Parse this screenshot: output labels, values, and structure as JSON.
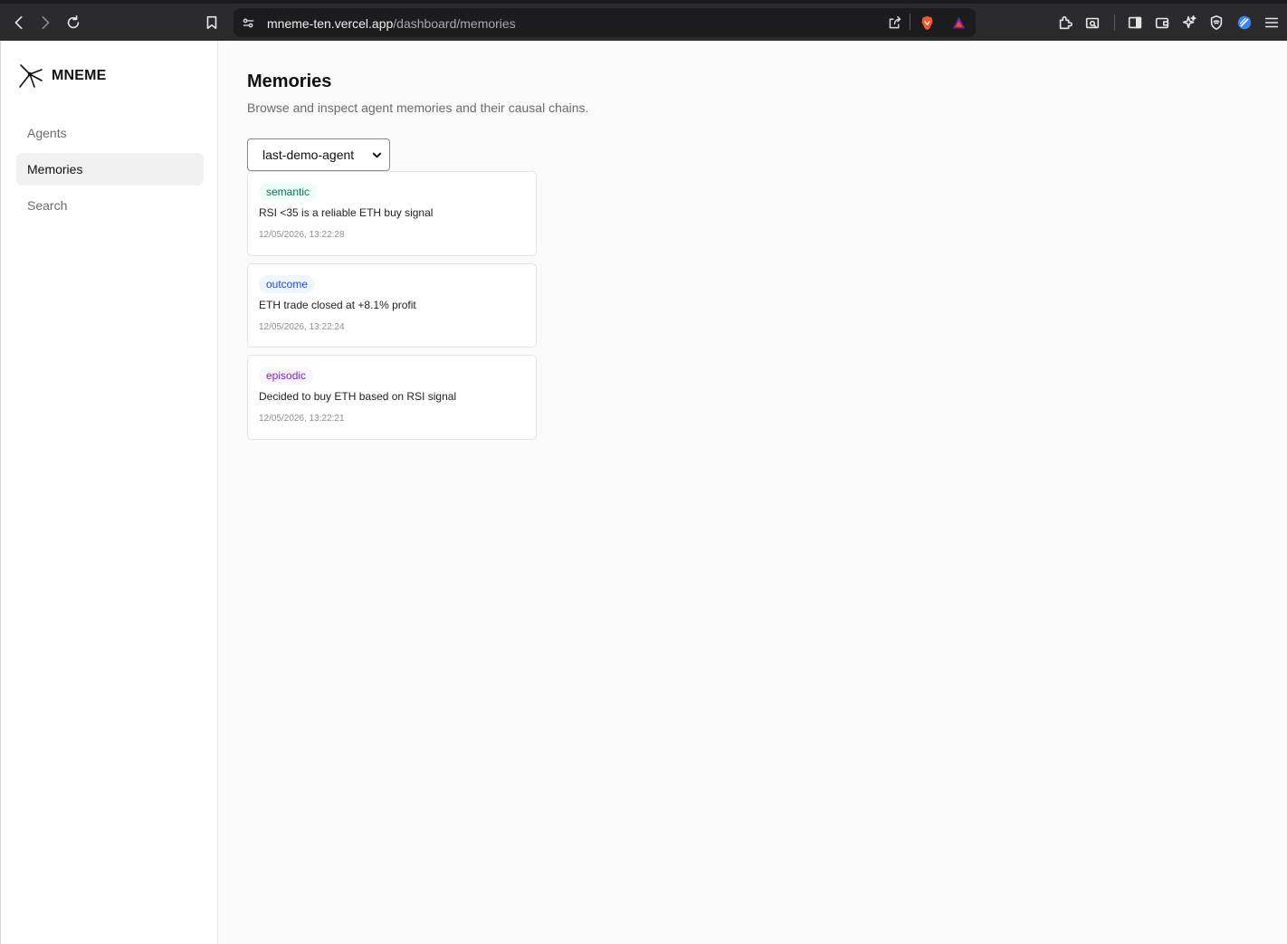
{
  "browser": {
    "url_host": "mneme-ten.vercel.app",
    "url_path": "/dashboard/memories"
  },
  "sidebar": {
    "brand": "MNEME",
    "items": [
      {
        "label": "Agents",
        "active": false
      },
      {
        "label": "Memories",
        "active": true
      },
      {
        "label": "Search",
        "active": false
      }
    ]
  },
  "main": {
    "title": "Memories",
    "subtitle": "Browse and inspect agent memories and their causal chains.",
    "agent_select": {
      "value": "last-demo-agent"
    },
    "memories": [
      {
        "type": "semantic",
        "text": "RSI <35 is a reliable ETH buy signal",
        "time": "12/05/2026, 13:22:28",
        "badge_bg": "#ecfdf5",
        "badge_fg": "#047857"
      },
      {
        "type": "outcome",
        "text": "ETH trade closed at +8.1% profit",
        "time": "12/05/2026, 13:22:24",
        "badge_bg": "#eff6ff",
        "badge_fg": "#1d4ed8"
      },
      {
        "type": "episodic",
        "text": "Decided to buy ETH based on RSI signal",
        "time": "12/05/2026, 13:22:21",
        "badge_bg": "#faf5ff",
        "badge_fg": "#7e22ce"
      }
    ]
  }
}
